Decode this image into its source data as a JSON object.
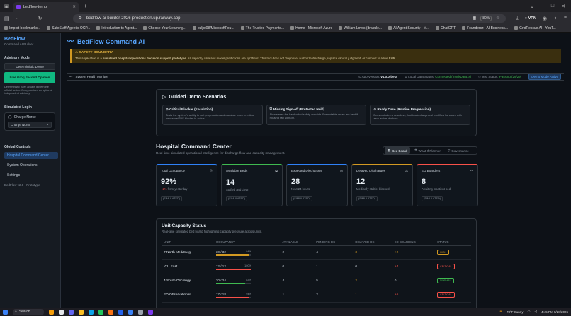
{
  "browser": {
    "tab_title": "bedflow-temp",
    "url": "bedflow-ai-builder-2026-production.up.railway.app",
    "zoom": "80%",
    "vpn": "VPN",
    "bookmarks": [
      "Import bookmarks...",
      "SafeStaff Agentic OCP...",
      "Introduction to Agent...",
      "Choose Your Learning...",
      "kuljot08/MicrosoftFou...",
      "The Trusted Payments...",
      "Home - Microsoft Azure",
      "William Low's (dracule...",
      "AI Agent Security - M...",
      "ChatGPT",
      "Foundercz | AI Business...",
      "GridRescue AI - YouT..."
    ]
  },
  "sidebar": {
    "brand": "BedFlow",
    "brand_sub": "Command AI Builder",
    "advisory_label": "Advisory Mode",
    "deterministic_btn": "Deterministic Demo",
    "live_btn": "Live Groq Second Opinion",
    "advisory_note": "Deterministic rules always govern the official action. Groq provides an optional independent advisory.",
    "role_section": "Simulated Login",
    "role_label": "Charge Nurse",
    "role_select": "Charge Nurse",
    "global_label": "Global Controls",
    "nav": [
      "Hospital Command Center",
      "System Operations",
      "Settings"
    ],
    "version": "BedFlow v2.0 - Prototype"
  },
  "header": {
    "title": "BedFlow Command AI",
    "banner_title": "SAFETY BOUNDARY",
    "banner_prefix": "This application is a ",
    "banner_emph": "simulated hospital operations decision support prototype.",
    "banner_rest": " All capacity data and model predictions are synthetic. This tool does not diagnose, authorize discharge, replace clinical judgment, or connect to a live EHR."
  },
  "status": {
    "label": "System Health Monitor",
    "app_version_label": "App Version:",
    "app_version": "v1.0.0-beta",
    "local_label": "Local Data Status:",
    "local_value": "Connected (mockData.ts)",
    "test_label": "Test Status:",
    "test_value": "Passing (29/29)",
    "demo_btn": "Demo Mode Active"
  },
  "guided": {
    "title": "Guided Demo Scenarios",
    "cards": [
      {
        "title": "Critical Blocker (Escalation)",
        "body": "Tests the system's ability to halt progression and escalate when a critical insurance/SNF blocker is active."
      },
      {
        "title": "Missing Sign-off (Protected Hold)",
        "body": "Showcases the hardcoded safety override. Even stable cases are held if missing MD sign-off."
      },
      {
        "title": "Ready Case (Routine Progression)",
        "body": "Demonstrates a seamless, fast-tracked approval workflow for cases with zero active blockers."
      }
    ]
  },
  "command": {
    "title": "Hospital Command Center",
    "subtitle": "Real-time simulated operational intelligence for discharge flow and capacity management.",
    "views": [
      "Bed Board",
      "What-If Planner",
      "Governance"
    ]
  },
  "kpis": [
    {
      "label": "Total Occupancy",
      "value": "92%",
      "sub_prefix": "+2%",
      "sub": " from yesterday",
      "tag": "(SIMULATED)",
      "accent": "#2f81f7",
      "icon": "people-icon"
    },
    {
      "label": "Available Beds",
      "value": "14",
      "sub_prefix": "",
      "sub": "Staffed and clean",
      "tag": "(SIMULATED)",
      "accent": "#3fb950",
      "icon": "bed-icon"
    },
    {
      "label": "Expected Discharges",
      "value": "28",
      "sub_prefix": "",
      "sub": "Next 24 hours",
      "tag": "(SIMULATED)",
      "accent": "#2f81f7",
      "icon": "target-icon"
    },
    {
      "label": "Delayed Discharges",
      "value": "12",
      "sub_prefix": "",
      "sub": "Medically stable, blocked",
      "tag": "(SIMULATED)",
      "accent": "#d29922",
      "icon": "warning-icon"
    },
    {
      "label": "ED Boarders",
      "value": "8",
      "sub_prefix": "",
      "sub": "Awaiting inpatient bed",
      "tag": "(SIMULATED)",
      "accent": "#f85149",
      "icon": "pulse-icon"
    }
  ],
  "units": {
    "title": "Unit Capacity Status",
    "subtitle": "Real-time simulated bed board highlighting capacity pressure across units.",
    "columns": [
      "UNIT",
      "OCCUPANCY",
      "AVAILABLE",
      "PENDING DC",
      "DELAYED DC",
      "ED BOARDING",
      "STATUS"
    ],
    "rows": [
      {
        "unit": "7 North Med/Surg",
        "occ": "30 / 32",
        "pct": "94%",
        "fill": 0.94,
        "fill_color": "#d29922",
        "available": "2",
        "pending": "4",
        "delayed": "3",
        "delayed_color": "#d29922",
        "ed": "+2",
        "ed_color": "#d29922",
        "status": "HIGH",
        "status_color": "#d29922"
      },
      {
        "unit": "ICU East",
        "occ": "12 / 12",
        "pct": "100%",
        "fill": 1.0,
        "fill_color": "#f85149",
        "available": "0",
        "pending": "1",
        "delayed": "0",
        "delayed_color": "#c9d1d9",
        "ed": "+4",
        "ed_color": "#f85149",
        "status": "CRITICAL",
        "status_color": "#f85149"
      },
      {
        "unit": "4 South Oncology",
        "occ": "20 / 24",
        "pct": "83%",
        "fill": 0.83,
        "fill_color": "#3fb950",
        "available": "4",
        "pending": "5",
        "delayed": "2",
        "delayed_color": "#d29922",
        "ed": "0",
        "ed_color": "#c9d1d9",
        "status": "NORMAL",
        "status_color": "#3fb950"
      },
      {
        "unit": "ED Observational",
        "occ": "17 / 18",
        "pct": "94%",
        "fill": 0.94,
        "fill_color": "#f85149",
        "available": "1",
        "pending": "2",
        "delayed": "1",
        "delayed_color": "#d29922",
        "ed": "+5",
        "ed_color": "#f85149",
        "status": "CRITICAL",
        "status_color": "#f85149"
      }
    ]
  },
  "taskbar": {
    "search": "Search",
    "weather": "78°F",
    "weather_sub": "Sunny",
    "time": "4:45 PM",
    "date": "8/28/2026"
  }
}
